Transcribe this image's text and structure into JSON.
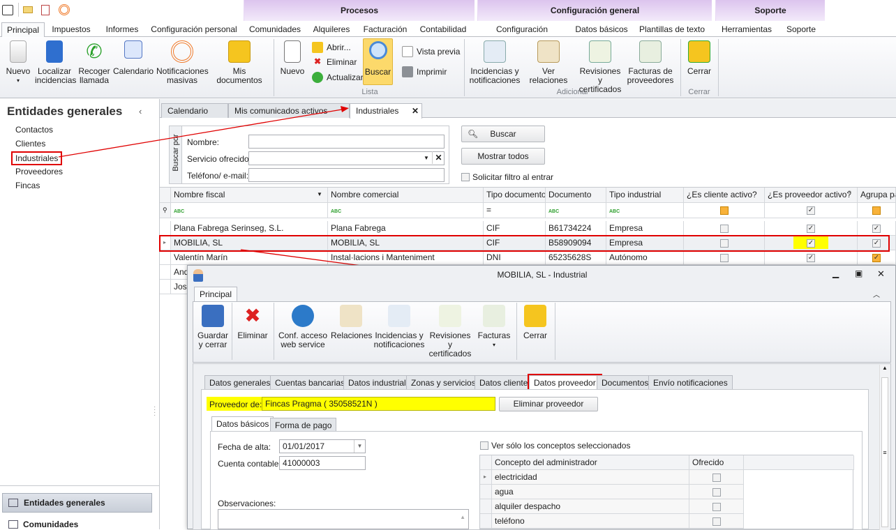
{
  "quick_icons": [
    "app-menu-icon",
    "mail-icon",
    "clipboard-icon",
    "broadcast-icon"
  ],
  "context_groups": {
    "procesos": "Procesos",
    "config": "Configuración general",
    "soporte": "Soporte"
  },
  "ribbon_tabs": [
    "Principal",
    "Impuestos",
    "Informes",
    "Configuración personal",
    "Comunidades",
    "Alquileres",
    "Facturación",
    "Contabilidad",
    "Configuración general",
    "Datos básicos",
    "Plantillas de texto",
    "Herramientas",
    "Soporte"
  ],
  "ribbon": {
    "nuevo": "Nuevo",
    "localizar": "Localizar incidencias",
    "recoger": "Recoger llamada",
    "calendario": "Calendario",
    "notificaciones": "Notificaciones masivas",
    "misdocs": "Mis documentos",
    "lista_nuevo": "Nuevo",
    "abrir": "Abrir...",
    "eliminar": "Eliminar",
    "actualizar": "Actualizar",
    "buscar": "Buscar",
    "vista_previa": "Vista previa",
    "imprimir": "Imprimir",
    "lista_group": "Lista",
    "incidencias": "Incidencias y notificaciones",
    "relaciones": "Ver relaciones",
    "revisiones": "Revisiones y certificados",
    "facturas": "Facturas de proveedores",
    "adicional_group": "Adicional",
    "cerrar": "Cerrar",
    "cerrar_group": "Cerrar"
  },
  "sidebar": {
    "title": "Entidades generales",
    "items": [
      "Contactos",
      "Clientes",
      "Industriales",
      "Proveedores",
      "Fincas"
    ],
    "bottom": [
      "Entidades generales",
      "Comunidades"
    ]
  },
  "doc_tabs": [
    "Calendario",
    "Mis comunicados activos",
    "Industriales"
  ],
  "search": {
    "vertical_label": "Buscar por",
    "nombre": "Nombre:",
    "servicio": "Servicio ofrecido:",
    "telefono": "Teléfono/ e-mail:",
    "buscar": "Buscar",
    "mostrar": "Mostrar todos",
    "solicitar": "Solicitar filtro al entrar"
  },
  "grid": {
    "columns": [
      "Nombre fiscal",
      "Nombre comercial",
      "Tipo documento",
      "Documento",
      "Tipo industrial",
      "¿Es cliente activo?",
      "¿Es proveedor activo?",
      "Agrupa pag"
    ],
    "rows": [
      {
        "fiscal": "Plana Fabrega Serinseg, S.L.",
        "comercial": "Plana Fabrega",
        "tipo": "CIF",
        "doc": "B61734224",
        "ind": "Empresa",
        "cliente": false,
        "proveedor": true,
        "agrupa": true
      },
      {
        "fiscal": "MOBILIA, SL",
        "comercial": "MOBILIA, SL",
        "tipo": "CIF",
        "doc": "B58909094",
        "ind": "Empresa",
        "cliente": false,
        "proveedor": true,
        "agrupa": true
      },
      {
        "fiscal": "Valentín Marín",
        "comercial": "Instal·lacions i Manteniment",
        "tipo": "DNI",
        "doc": "65235628S",
        "ind": "Autónomo",
        "cliente": false,
        "proveedor": true,
        "agrupa": true
      },
      {
        "fiscal": "And",
        "comercial": "",
        "tipo": "",
        "doc": "",
        "ind": "",
        "cliente": null,
        "proveedor": null,
        "agrupa": null
      },
      {
        "fiscal": "Jose",
        "comercial": "",
        "tipo": "",
        "doc": "",
        "ind": "",
        "cliente": null,
        "proveedor": null,
        "agrupa": null
      }
    ]
  },
  "dialog": {
    "title": "MOBILIA, SL - Industrial",
    "ribbon_tab": "Principal",
    "buttons": [
      "Guardar y cerrar",
      "Eliminar",
      "Conf. acceso web service",
      "Relaciones",
      "Incidencias y notificaciones",
      "Revisiones y certificados",
      "Facturas",
      "Cerrar"
    ],
    "tabs": [
      "Datos generales",
      "Cuentas bancarias",
      "Datos industrial",
      "Zonas y servicios",
      "Datos cliente",
      "Datos proveedor",
      "Documentos",
      "Envío notificaciones"
    ],
    "proveedor_label": "Proveedor de:",
    "proveedor_value": "Fincas Pragma ( 35058521N )",
    "eliminar_proveedor": "Eliminar proveedor",
    "subtabs": [
      "Datos básicos",
      "Forma de pago"
    ],
    "fecha_label": "Fecha de alta:",
    "fecha_value": "01/01/2017",
    "cuenta_label": "Cuenta contable:",
    "cuenta_value": "41000003",
    "observaciones": "Observaciones:",
    "ver_solo": "Ver sólo los conceptos seleccionados",
    "concept_cols": [
      "Concepto del administrador",
      "Ofrecido"
    ],
    "concepts": [
      "electricidad",
      "agua",
      "alquiler despacho",
      "teléfono"
    ]
  },
  "colors": {
    "highlight": "#ffff00",
    "annotation": "#e00000",
    "buscar_active": "#fcd96b"
  }
}
